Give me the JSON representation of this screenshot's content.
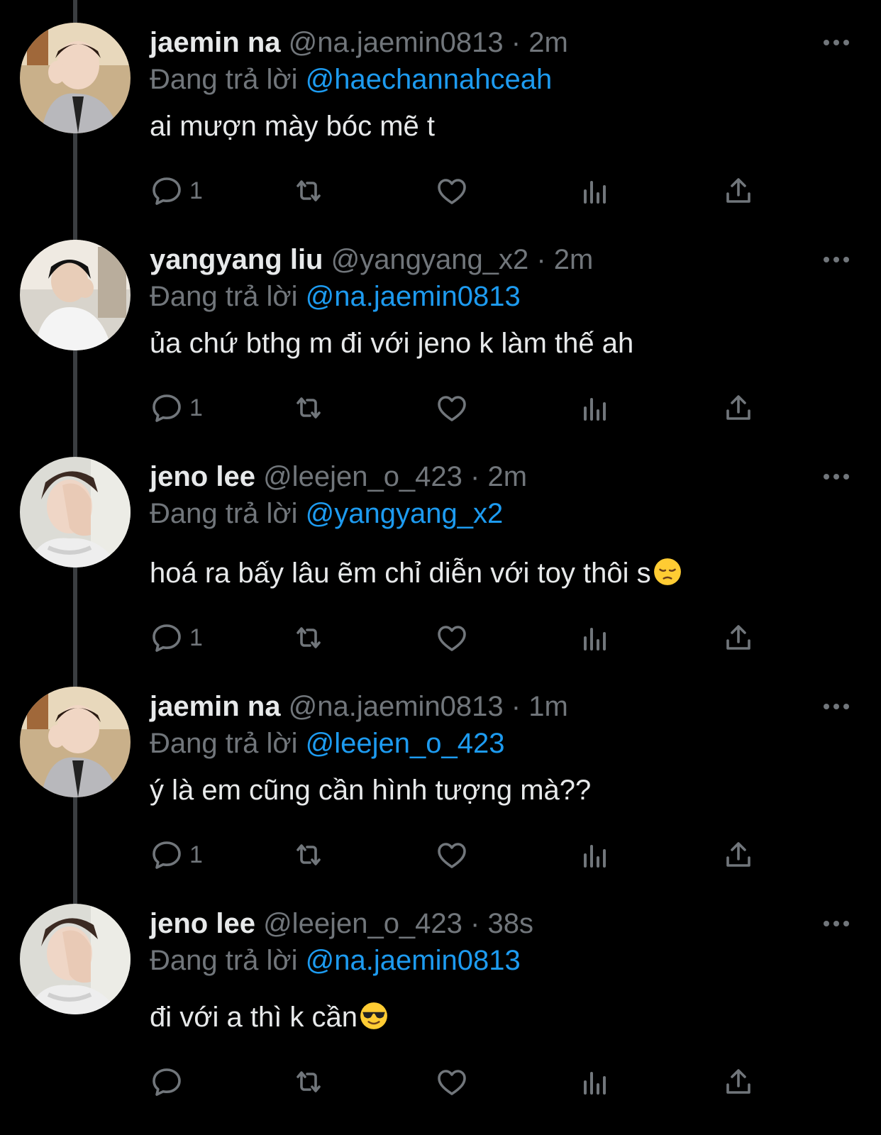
{
  "tweets": [
    {
      "name": "jaemin na",
      "handle": "@na.jaemin0813",
      "time": "2m",
      "reply_prefix": "Đang trả lời",
      "reply_to": "@haechannahceah",
      "text": "ai mượn mày bóc mẽ t",
      "emoji": "",
      "reply_count": "1",
      "avatar": "avatar-jaemin"
    },
    {
      "name": "yangyang liu",
      "handle": "@yangyang_x2",
      "time": "2m",
      "reply_prefix": "Đang trả lời",
      "reply_to": "@na.jaemin0813",
      "text": "ủa chứ bthg m đi với jeno k làm thế ah",
      "emoji": "",
      "reply_count": "1",
      "avatar": "avatar-yangyang"
    },
    {
      "name": "jeno lee",
      "handle": "@leejen_o_423",
      "time": "2m",
      "reply_prefix": "Đang trả lời",
      "reply_to": "@yangyang_x2",
      "text": "hoá ra bấy lâu ẽm chỉ diễn với toy thôi s",
      "emoji": "pensive-face",
      "reply_count": "1",
      "avatar": "avatar-jeno"
    },
    {
      "name": "jaemin na",
      "handle": "@na.jaemin0813",
      "time": "1m",
      "reply_prefix": "Đang trả lời",
      "reply_to": "@leejen_o_423",
      "text": "ý là em cũng cần hình tượng mà??",
      "emoji": "",
      "reply_count": "1",
      "avatar": "avatar-jaemin"
    },
    {
      "name": "jeno lee",
      "handle": "@leejen_o_423",
      "time": "38s",
      "reply_prefix": "Đang trả lời",
      "reply_to": "@na.jaemin0813",
      "text": "đi với a thì k cần",
      "emoji": "sunglasses-face",
      "reply_count": "",
      "avatar": "avatar-jeno"
    }
  ],
  "separator": "·",
  "colors": {
    "background": "#000000",
    "text": "#e7e9ea",
    "secondary": "#71767b",
    "link": "#1d9bf0",
    "thread_line": "#3a3d40"
  },
  "icons": [
    "reply-icon",
    "retweet-icon",
    "like-icon",
    "views-icon",
    "share-icon",
    "more-icon"
  ]
}
